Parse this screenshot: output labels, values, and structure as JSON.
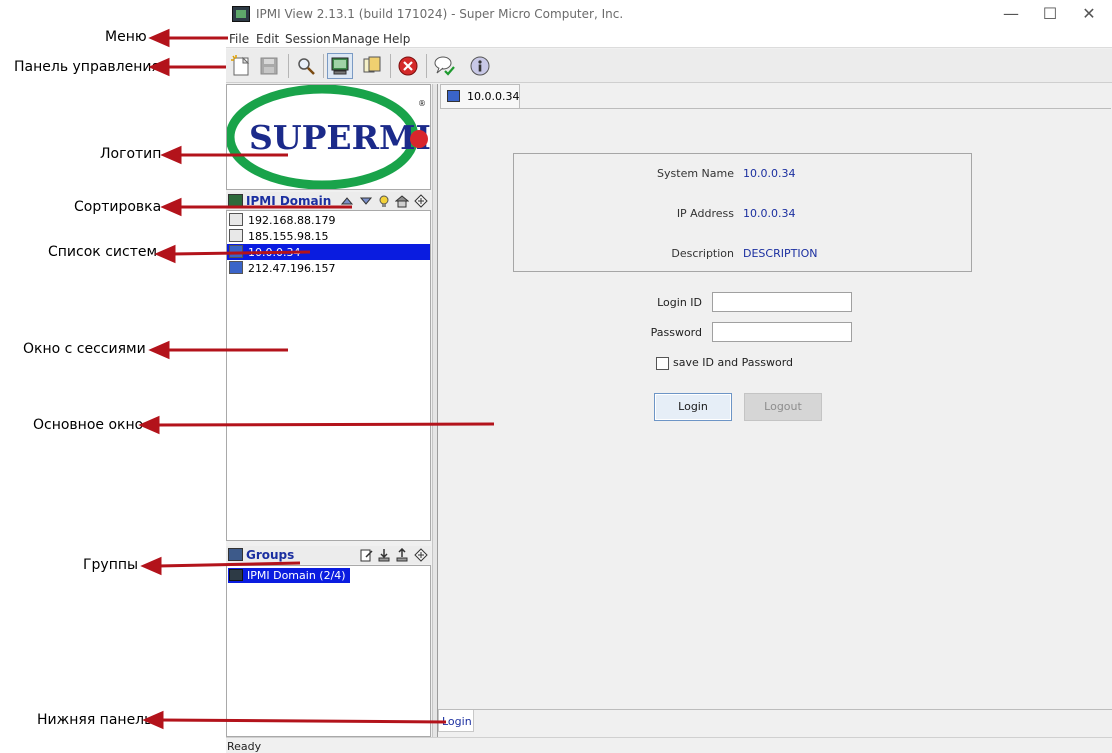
{
  "annotations": {
    "menu": "Меню",
    "toolbar": "Панель управления",
    "logo": "Логотип",
    "sorting": "Сортировка",
    "system_list": "Список систем",
    "sessions_window": "Окно с сессиями",
    "main_window": "Основное окно",
    "groups": "Группы",
    "bottom_panel": "Нижняя панель",
    "arrow_color": "#b3131b"
  },
  "window": {
    "title": "IPMI View 2.13.1 (build 171024) - Super Micro Computer, Inc.",
    "minimize": "—",
    "maximize": "☐",
    "close": "✕"
  },
  "menubar": {
    "items": [
      "File",
      "Edit",
      "Session",
      "Manage",
      "Help"
    ]
  },
  "toolbar": {
    "icons": [
      "new-icon",
      "save-icon",
      "search-icon",
      "monitor-icon",
      "windows-icon",
      "stop-icon",
      "chat-icon",
      "info-icon"
    ],
    "active": "monitor-icon"
  },
  "logo": {
    "text": "SUPERMICR",
    "registered": "®",
    "brand_blue": "#1b2a8a",
    "brand_green": "#19a34a",
    "brand_red": "#d8262c"
  },
  "ipmi_domain": {
    "title": "IPMI Domain",
    "systems": [
      {
        "ip": "192.168.88.179",
        "selected": false,
        "online": false
      },
      {
        "ip": "185.155.98.15",
        "selected": false,
        "online": false
      },
      {
        "ip": "10.0.0.34",
        "selected": true,
        "online": true
      },
      {
        "ip": "212.47.196.157",
        "selected": false,
        "online": true
      }
    ]
  },
  "groups": {
    "title": "Groups",
    "items": [
      "IPMI Domain (2/4)"
    ]
  },
  "main": {
    "tab_label": "10.0.0.34",
    "system_name_label": "System Name",
    "system_name_value": "10.0.0.34",
    "ip_address_label": "IP Address",
    "ip_address_value": "10.0.0.34",
    "description_label": "Description",
    "description_value": "DESCRIPTION",
    "login_id_label": "Login ID",
    "login_id_value": "",
    "password_label": "Password",
    "password_value": "",
    "save_label": "save ID and Password",
    "save_checked": false,
    "login_button": "Login",
    "logout_button": "Logout",
    "bottom_tab": "Login"
  },
  "status": {
    "text": "Ready"
  }
}
